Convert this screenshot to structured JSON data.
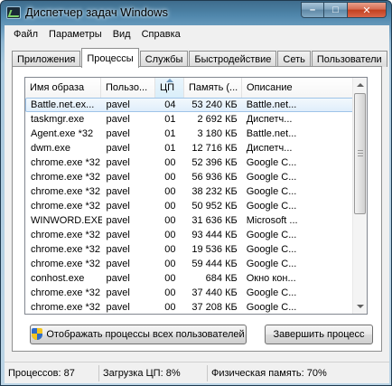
{
  "window": {
    "title": "Диспетчер задач Windows"
  },
  "caption": {
    "minimize": "–",
    "maximize": "□",
    "close": "✕"
  },
  "menu": [
    "Файл",
    "Параметры",
    "Вид",
    "Справка"
  ],
  "tabs": [
    "Приложения",
    "Процессы",
    "Службы",
    "Быстродействие",
    "Сеть",
    "Пользователи"
  ],
  "active_tab": "Процессы",
  "table": {
    "columns": [
      "Имя образа",
      "Пользо...",
      "ЦП",
      "Память (...",
      "Описание"
    ],
    "sorted_column": "ЦП",
    "rows": [
      [
        "Battle.net.ex...",
        "pavel",
        "04",
        "53 240 КБ",
        "Battle.net..."
      ],
      [
        "taskmgr.exe",
        "pavel",
        "01",
        "2 692 КБ",
        "Диспетч..."
      ],
      [
        "Agent.exe *32",
        "pavel",
        "01",
        "3 180 КБ",
        "Battle.net..."
      ],
      [
        "dwm.exe",
        "pavel",
        "01",
        "12 716 КБ",
        "Диспетч..."
      ],
      [
        "chrome.exe *32",
        "pavel",
        "00",
        "52 396 КБ",
        "Google C..."
      ],
      [
        "chrome.exe *32",
        "pavel",
        "00",
        "56 936 КБ",
        "Google C..."
      ],
      [
        "chrome.exe *32",
        "pavel",
        "00",
        "38 232 КБ",
        "Google C..."
      ],
      [
        "chrome.exe *32",
        "pavel",
        "00",
        "50 952 КБ",
        "Google C..."
      ],
      [
        "WINWORD.EXE",
        "pavel",
        "00",
        "31 636 КБ",
        "Microsoft ..."
      ],
      [
        "chrome.exe *32",
        "pavel",
        "00",
        "93 444 КБ",
        "Google C..."
      ],
      [
        "chrome.exe *32",
        "pavel",
        "00",
        "19 536 КБ",
        "Google C..."
      ],
      [
        "chrome.exe *32",
        "pavel",
        "00",
        "59 444 КБ",
        "Google C..."
      ],
      [
        "conhost.exe",
        "pavel",
        "00",
        "684 КБ",
        "Окно кон..."
      ],
      [
        "chrome.exe *32",
        "pavel",
        "00",
        "37 440 КБ",
        "Google C..."
      ],
      [
        "chrome.exe *32",
        "pavel",
        "00",
        "37 208 КБ",
        "Google C..."
      ]
    ],
    "selected_row": 0
  },
  "buttons": {
    "show_all": "Отображать процессы всех пользователей",
    "end_process": "Завершить процесс"
  },
  "status": {
    "processes": "Процессов: 87",
    "cpu": "Загрузка ЦП: 8%",
    "memory": "Физическая память: 70%"
  },
  "colors": {
    "selection": "#e0eefb",
    "title_gradient": "#4f86ab",
    "close_button": "#c2401f"
  }
}
